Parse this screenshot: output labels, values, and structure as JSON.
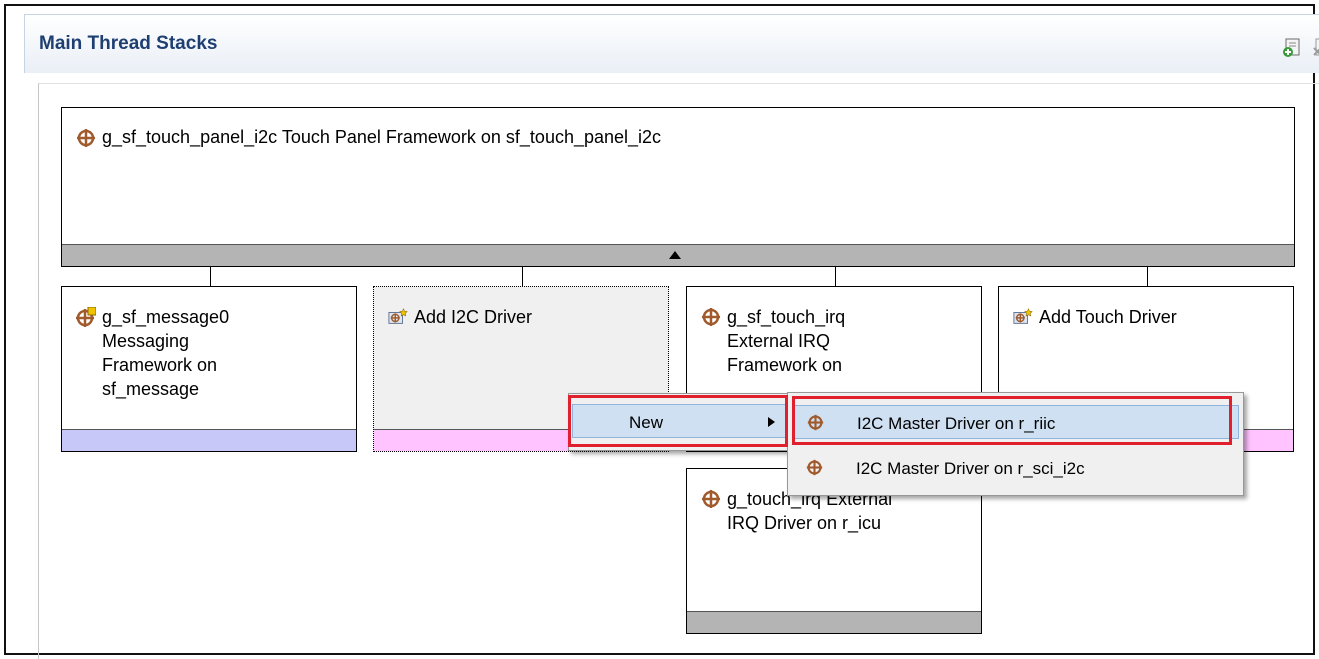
{
  "panel": {
    "title": "Main Thread Stacks"
  },
  "header_icons": [
    "add-stack-icon",
    "remove-stack-icon"
  ],
  "top_block": {
    "label": "g_sf_touch_panel_i2c Touch Panel Framework on sf_touch_panel_i2c"
  },
  "blocks": [
    {
      "label_lines": [
        "g_sf_message0",
        "Messaging",
        "Framework on",
        "sf_message"
      ]
    },
    {
      "label_lines": [
        "Add I2C Driver"
      ]
    },
    {
      "label_lines": [
        "g_sf_touch_irq",
        "External IRQ",
        "Framework on"
      ]
    },
    {
      "label_lines": [
        "Add Touch Driver"
      ]
    }
  ],
  "sub_block": {
    "label_lines": [
      "g_touch_irq External",
      "IRQ Driver on r_icu"
    ]
  },
  "context_menu": {
    "label": "New"
  },
  "submenu": {
    "items": [
      {
        "label": "I2C Master Driver on r_riic"
      },
      {
        "label": "I2C Master Driver on r_sci_i2c"
      }
    ]
  },
  "colors": {
    "accent_red": "#e0202c",
    "bar_gray": "#b4b4b4",
    "bar_lavender": "#c8c8f8",
    "bar_pink": "#ffc4ff",
    "header_text": "#1f3f73"
  }
}
